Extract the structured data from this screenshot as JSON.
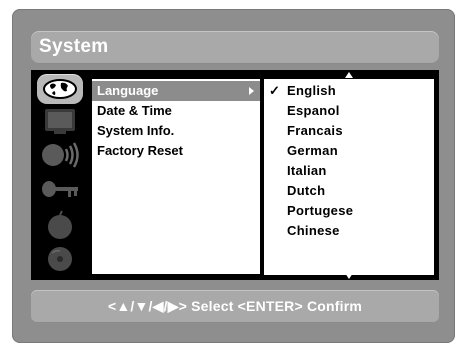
{
  "header": {
    "title": "System"
  },
  "sidebar": {
    "icons": [
      {
        "name": "globe-icon",
        "selected": true
      },
      {
        "name": "tv-icon",
        "selected": false
      },
      {
        "name": "speaker-icon",
        "selected": false
      },
      {
        "name": "key-icon",
        "selected": false
      },
      {
        "name": "apple-icon",
        "selected": false
      },
      {
        "name": "disc-icon",
        "selected": false
      }
    ]
  },
  "menu": {
    "items": [
      {
        "label": "Language",
        "selected": true
      },
      {
        "label": "Date & Time",
        "selected": false
      },
      {
        "label": "System Info.",
        "selected": false
      },
      {
        "label": "Factory Reset",
        "selected": false
      }
    ]
  },
  "languages": {
    "selected": "English",
    "check_mark": "✓",
    "items": [
      "English",
      "Espanol",
      "Francais",
      "German",
      "Italian",
      "Dutch",
      "Portugese",
      "Chinese"
    ]
  },
  "footer": {
    "hint": "<▲/▼/◀/▶> Select  <ENTER> Confirm"
  },
  "colors": {
    "bezel": "#8e8e8e",
    "bar": "#a9a9a9",
    "content_bg": "#000000",
    "selected_menu": "#8c8c8c",
    "selected_icon": "#b9b9b9",
    "text_light": "#ffffff"
  }
}
